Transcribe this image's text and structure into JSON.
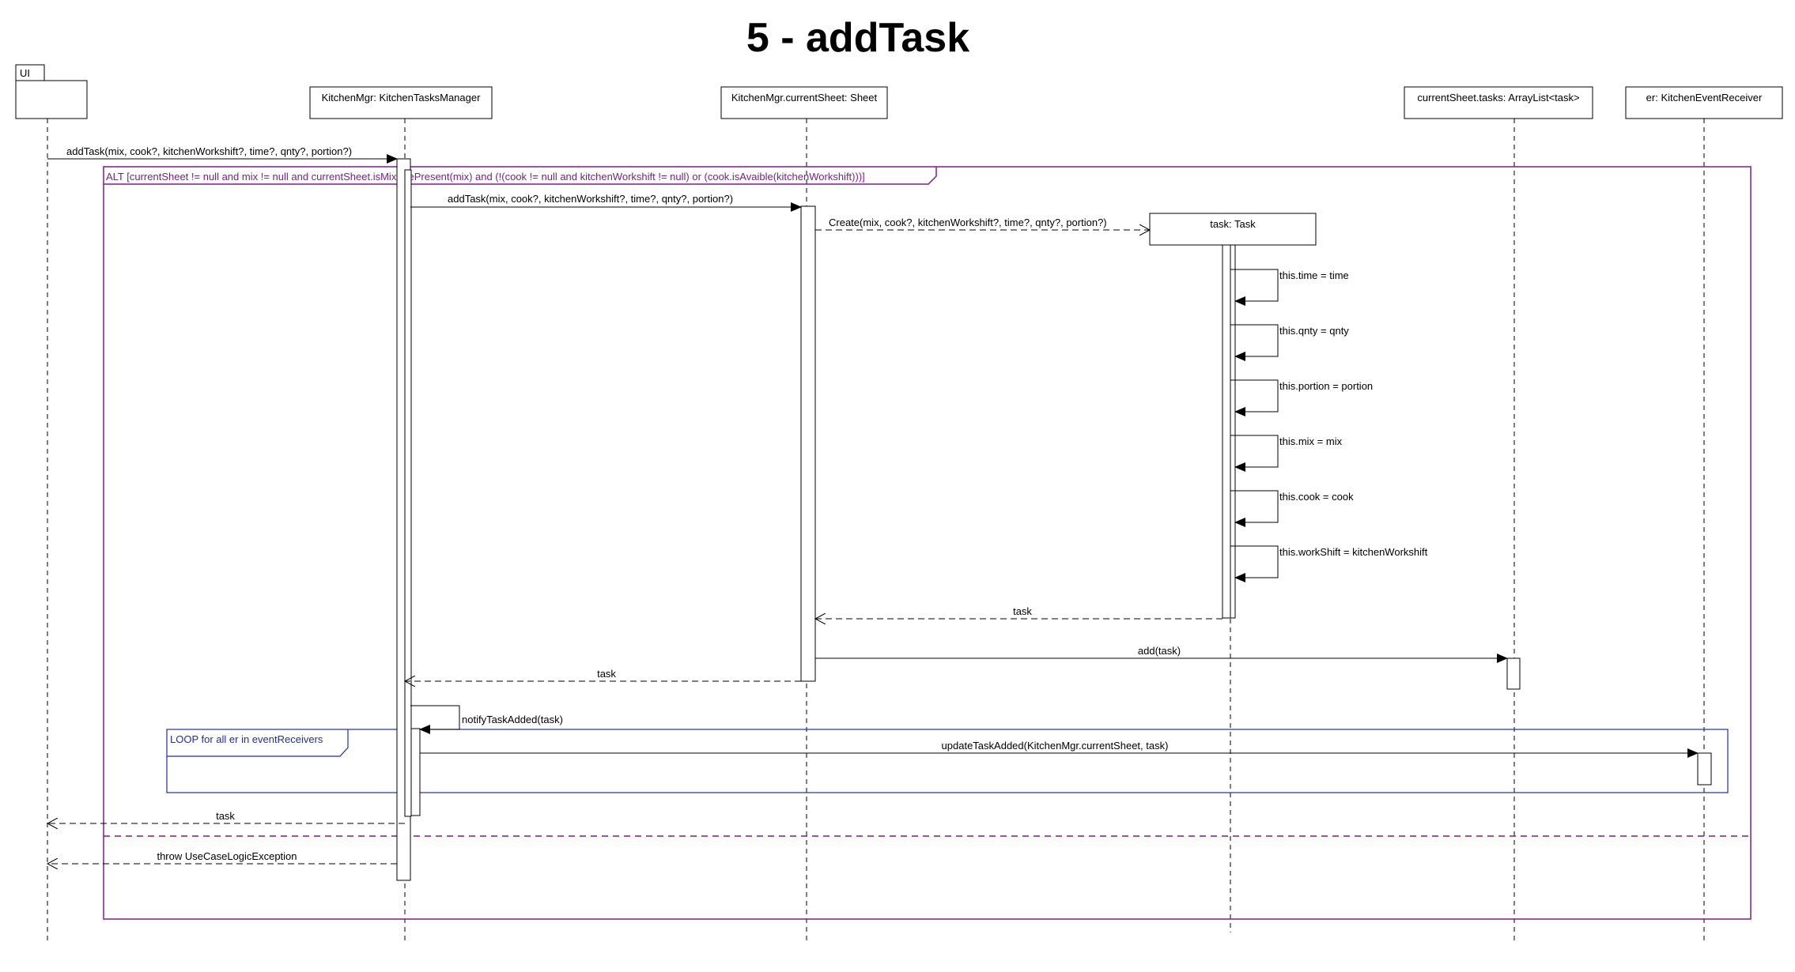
{
  "title": "5 - addTask",
  "package_label": "UI",
  "participants": [
    {
      "id": "km",
      "label": "KitchenMgr: KitchenTasksManager"
    },
    {
      "id": "sheet",
      "label": "KitchenMgr.currentSheet: Sheet"
    },
    {
      "id": "task",
      "label": "task: Task"
    },
    {
      "id": "tasks",
      "label": "currentSheet.tasks: ArrayList<task>"
    },
    {
      "id": "er",
      "label": "er: KitchenEventReceiver"
    }
  ],
  "fragments": {
    "alt_guard": "ALT [currentSheet != null and mix != null and currentSheet.isMixturePresent(mix) and (!(cook != null and kitchenWorkshift != null) or (cook.isAvaible(kitchenWorkshift)))]",
    "loop_guard": "LOOP for all er in eventReceivers"
  },
  "messages": {
    "m1": "addTask(mix, cook?, kitchenWorkshift?, time?, qnty?, portion?)",
    "m2": "addTask(mix, cook?, kitchenWorkshift?, time?, qnty?, portion?)",
    "m3": "Create(mix, cook?, kitchenWorkshift?, time?, qnty?, portion?)",
    "s1": "this.time = time",
    "s2": "this.qnty = qnty",
    "s3": "this.portion = portion",
    "s4": "this.mix = mix",
    "s5": "this.cook = cook",
    "s6": "this.workShift = kitchenWorkshift",
    "r1": "task",
    "m4": "add(task)",
    "r2": "task",
    "m5": "notifyTaskAdded(task)",
    "m6": "updateTaskAdded(KitchenMgr.currentSheet, task)",
    "r3": "task",
    "r4": "throw UseCaseLogicException"
  },
  "colors": {
    "alt_frame": "#7b1f8c",
    "loop_frame": "#1f2ea0",
    "line": "#000000"
  }
}
